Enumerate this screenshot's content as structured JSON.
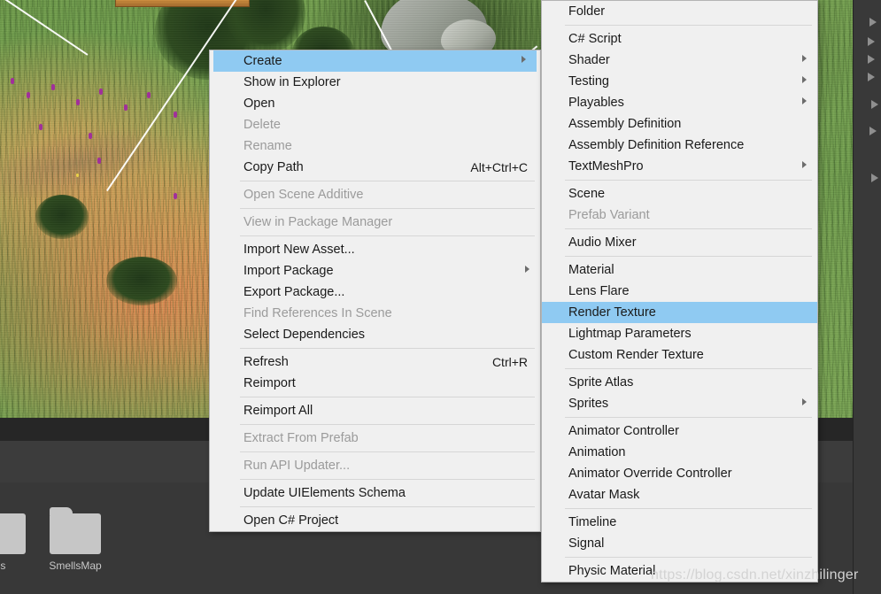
{
  "scene": {
    "view_name": "scene-view",
    "folders": [
      {
        "label": "es"
      },
      {
        "label": "SmellsMap"
      }
    ]
  },
  "context_menu": {
    "name": "project-context-menu",
    "items": [
      {
        "label": "Create",
        "shortcut": "",
        "submenu": true,
        "disabled": false,
        "selected": true
      },
      {
        "label": "Show in Explorer",
        "shortcut": "",
        "submenu": false,
        "disabled": false,
        "selected": false
      },
      {
        "label": "Open",
        "shortcut": "",
        "submenu": false,
        "disabled": false,
        "selected": false
      },
      {
        "label": "Delete",
        "shortcut": "",
        "submenu": false,
        "disabled": true,
        "selected": false
      },
      {
        "label": "Rename",
        "shortcut": "",
        "submenu": false,
        "disabled": true,
        "selected": false
      },
      {
        "label": "Copy Path",
        "shortcut": "Alt+Ctrl+C",
        "submenu": false,
        "disabled": false,
        "selected": false
      },
      {
        "separator": true
      },
      {
        "label": "Open Scene Additive",
        "shortcut": "",
        "submenu": false,
        "disabled": true,
        "selected": false
      },
      {
        "separator": true
      },
      {
        "label": "View in Package Manager",
        "shortcut": "",
        "submenu": false,
        "disabled": true,
        "selected": false
      },
      {
        "separator": true
      },
      {
        "label": "Import New Asset...",
        "shortcut": "",
        "submenu": false,
        "disabled": false,
        "selected": false
      },
      {
        "label": "Import Package",
        "shortcut": "",
        "submenu": true,
        "disabled": false,
        "selected": false
      },
      {
        "label": "Export Package...",
        "shortcut": "",
        "submenu": false,
        "disabled": false,
        "selected": false
      },
      {
        "label": "Find References In Scene",
        "shortcut": "",
        "submenu": false,
        "disabled": true,
        "selected": false
      },
      {
        "label": "Select Dependencies",
        "shortcut": "",
        "submenu": false,
        "disabled": false,
        "selected": false
      },
      {
        "separator": true
      },
      {
        "label": "Refresh",
        "shortcut": "Ctrl+R",
        "submenu": false,
        "disabled": false,
        "selected": false
      },
      {
        "label": "Reimport",
        "shortcut": "",
        "submenu": false,
        "disabled": false,
        "selected": false
      },
      {
        "separator": true
      },
      {
        "label": "Reimport All",
        "shortcut": "",
        "submenu": false,
        "disabled": false,
        "selected": false
      },
      {
        "separator": true
      },
      {
        "label": "Extract From Prefab",
        "shortcut": "",
        "submenu": false,
        "disabled": true,
        "selected": false
      },
      {
        "separator": true
      },
      {
        "label": "Run API Updater...",
        "shortcut": "",
        "submenu": false,
        "disabled": true,
        "selected": false
      },
      {
        "separator": true
      },
      {
        "label": "Update UIElements Schema",
        "shortcut": "",
        "submenu": false,
        "disabled": false,
        "selected": false
      },
      {
        "separator": true
      },
      {
        "label": "Open C# Project",
        "shortcut": "",
        "submenu": false,
        "disabled": false,
        "selected": false
      }
    ]
  },
  "create_submenu": {
    "name": "create-submenu",
    "items": [
      {
        "label": "Folder",
        "submenu": false,
        "disabled": false,
        "selected": false
      },
      {
        "separator": true
      },
      {
        "label": "C# Script",
        "submenu": false,
        "disabled": false,
        "selected": false
      },
      {
        "label": "Shader",
        "submenu": true,
        "disabled": false,
        "selected": false
      },
      {
        "label": "Testing",
        "submenu": true,
        "disabled": false,
        "selected": false
      },
      {
        "label": "Playables",
        "submenu": true,
        "disabled": false,
        "selected": false
      },
      {
        "label": "Assembly Definition",
        "submenu": false,
        "disabled": false,
        "selected": false
      },
      {
        "label": "Assembly Definition Reference",
        "submenu": false,
        "disabled": false,
        "selected": false
      },
      {
        "label": "TextMeshPro",
        "submenu": true,
        "disabled": false,
        "selected": false
      },
      {
        "separator": true
      },
      {
        "label": "Scene",
        "submenu": false,
        "disabled": false,
        "selected": false
      },
      {
        "label": "Prefab Variant",
        "submenu": false,
        "disabled": true,
        "selected": false
      },
      {
        "separator": true
      },
      {
        "label": "Audio Mixer",
        "submenu": false,
        "disabled": false,
        "selected": false
      },
      {
        "separator": true
      },
      {
        "label": "Material",
        "submenu": false,
        "disabled": false,
        "selected": false
      },
      {
        "label": "Lens Flare",
        "submenu": false,
        "disabled": false,
        "selected": false
      },
      {
        "label": "Render Texture",
        "submenu": false,
        "disabled": false,
        "selected": true
      },
      {
        "label": "Lightmap Parameters",
        "submenu": false,
        "disabled": false,
        "selected": false
      },
      {
        "label": "Custom Render Texture",
        "submenu": false,
        "disabled": false,
        "selected": false
      },
      {
        "separator": true
      },
      {
        "label": "Sprite Atlas",
        "submenu": false,
        "disabled": false,
        "selected": false
      },
      {
        "label": "Sprites",
        "submenu": true,
        "disabled": false,
        "selected": false
      },
      {
        "separator": true
      },
      {
        "label": "Animator Controller",
        "submenu": false,
        "disabled": false,
        "selected": false
      },
      {
        "label": "Animation",
        "submenu": false,
        "disabled": false,
        "selected": false
      },
      {
        "label": "Animator Override Controller",
        "submenu": false,
        "disabled": false,
        "selected": false
      },
      {
        "label": "Avatar Mask",
        "submenu": false,
        "disabled": false,
        "selected": false
      },
      {
        "separator": true
      },
      {
        "label": "Timeline",
        "submenu": false,
        "disabled": false,
        "selected": false
      },
      {
        "label": "Signal",
        "submenu": false,
        "disabled": false,
        "selected": false
      },
      {
        "separator": true
      },
      {
        "label": "Physic Material",
        "submenu": false,
        "disabled": false,
        "selected": false
      }
    ]
  },
  "watermark": {
    "text": "https://blog.csdn.net/xinzhilinger"
  },
  "colors": {
    "menu_background": "#f0f0f0",
    "menu_highlight": "#8fcaf2",
    "menu_text": "#1a1a1a",
    "menu_text_disabled": "#9b9b9b",
    "editor_background": "#383838",
    "folder_icon": "#c6c6c6"
  }
}
